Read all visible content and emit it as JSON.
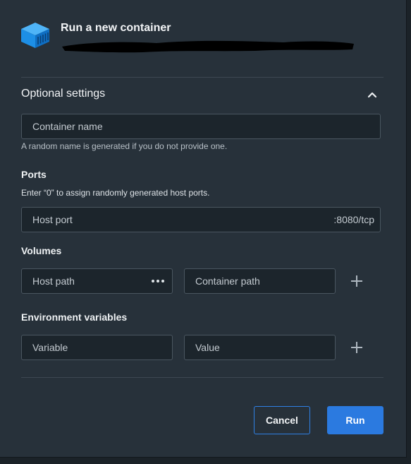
{
  "header": {
    "title": "Run a new container",
    "icon": "container-cube-icon"
  },
  "optional_settings": {
    "title": "Optional settings",
    "toggle_icon": "chevron-up-icon",
    "container_name": {
      "placeholder": "Container name",
      "help": "A random name is generated if you do not provide one."
    }
  },
  "ports": {
    "label": "Ports",
    "help": "Enter “0” to assign randomly generated host ports.",
    "host_port": {
      "placeholder": "Host port",
      "suffix": ":8080/tcp"
    }
  },
  "volumes": {
    "label": "Volumes",
    "host_path": {
      "placeholder": "Host path",
      "browse_icon": "more-dots-icon"
    },
    "container_path": {
      "placeholder": "Container path"
    },
    "add_icon": "plus-icon"
  },
  "environment": {
    "label": "Environment variables",
    "variable": {
      "placeholder": "Variable"
    },
    "value": {
      "placeholder": "Value"
    },
    "add_icon": "plus-icon"
  },
  "actions": {
    "cancel": "Cancel",
    "run": "Run"
  },
  "colors": {
    "dialog_bg": "#27313a",
    "field_bg": "#1c252c",
    "accent": "#2b7ae0",
    "cube": "#1d9bf0"
  }
}
